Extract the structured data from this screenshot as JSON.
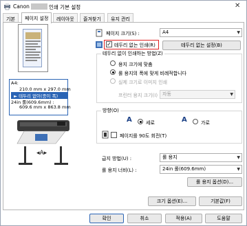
{
  "window": {
    "title_prefix": "Canon",
    "title_suffix": "인쇄 기본 설정",
    "close_glyph": "✕"
  },
  "tabs": [
    {
      "label": "기본"
    },
    {
      "label": "페이지 설정"
    },
    {
      "label": "레이아웃"
    },
    {
      "label": "즐겨찾기"
    },
    {
      "label": "유지 관리"
    }
  ],
  "info": {
    "line1": "A4:",
    "line2": "210.0 mm x 297.0 mm",
    "line3": "► 테두리 없이(종이 폭)",
    "line4": "24in 롤(609.6mm) :",
    "line5": "609.6 mm x 863.8 mm"
  },
  "page_size": {
    "label": "페이지 크기(S) :",
    "value": "A4"
  },
  "borderless": {
    "label": "테두리 없는 인쇄(R)",
    "checked": true,
    "settings_button": "테두리 없는 설정(B)"
  },
  "method_group": {
    "title": "테두리 없이 인쇄하는 방법(Z)",
    "opt1": "용지 크기에 맞춤",
    "opt2": "롤 용지의 폭에 맞게 비례적합니다",
    "opt3": "실제 크기로 이미지 인쇄",
    "printer_paper_label": "프린터 용지 크기(I) :",
    "printer_paper_value": "자동"
  },
  "orientation_group": {
    "title": "방향(O)",
    "portrait": "세로",
    "landscape": "가로",
    "rotate": "페이지를 90도 회전(T)"
  },
  "feed": {
    "label": "급지 방법(U) :",
    "value": "롤 용지"
  },
  "roll_width": {
    "label": "롤 용지 너비(L) :",
    "value": "24in 롤(609.6mm)",
    "options_button": "롤 용지 옵션(D)..."
  },
  "size_options_button": "크기 옵션(E)...",
  "defaults_button": "기본값(F)",
  "footer": {
    "ok": "확인",
    "cancel": "취소",
    "apply": "적용(A)",
    "help": "도움말"
  },
  "colors": {
    "accent": "#2a64b5",
    "highlight_border": "#e02020"
  }
}
